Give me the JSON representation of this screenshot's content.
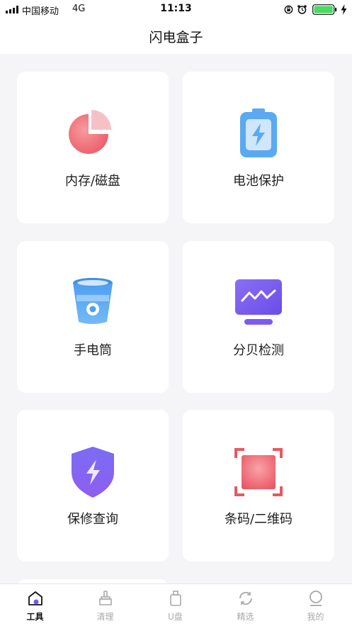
{
  "status_bar": {
    "carrier": "中国移动",
    "network": "4G",
    "time": "11:13"
  },
  "header": {
    "title": "闪电盒子"
  },
  "tools": [
    {
      "label": "内存/磁盘",
      "icon": "pie-chart-icon"
    },
    {
      "label": "电池保护",
      "icon": "battery-icon"
    },
    {
      "label": "手电筒",
      "icon": "flashlight-icon"
    },
    {
      "label": "分贝检测",
      "icon": "decibel-monitor-icon"
    },
    {
      "label": "保修查询",
      "icon": "shield-bolt-icon"
    },
    {
      "label": "条码/二维码",
      "icon": "scan-frame-icon"
    }
  ],
  "tabbar": {
    "active": "工具",
    "items": [
      {
        "label": "工具",
        "icon": "home-icon"
      },
      {
        "label": "清理",
        "icon": "broom-icon"
      },
      {
        "label": "U盘",
        "icon": "usb-drive-icon"
      },
      {
        "label": "精选",
        "icon": "refresh-icon"
      },
      {
        "label": "我的",
        "icon": "profile-icon"
      }
    ]
  },
  "colors": {
    "accent": "#6a5cf2",
    "coral": "#ee6a73",
    "blue": "#5aa9f2",
    "purple": "#7f66f0"
  }
}
